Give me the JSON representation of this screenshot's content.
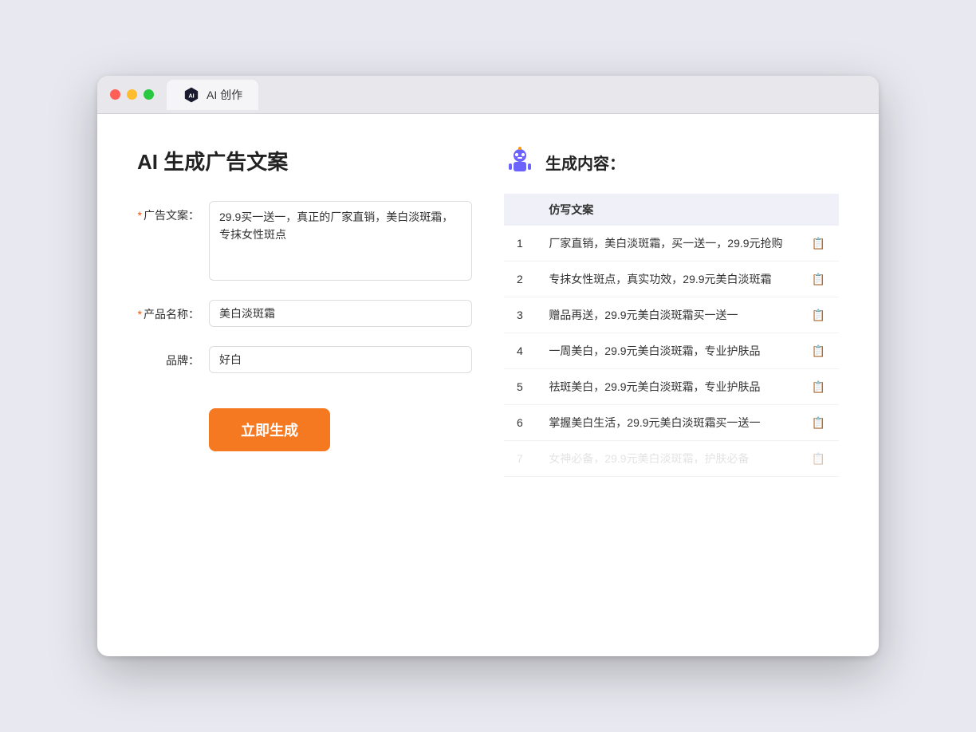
{
  "browser": {
    "tab_label": "AI 创作"
  },
  "page": {
    "title": "AI 生成广告文案"
  },
  "form": {
    "ad_copy_label": "广告文案：",
    "ad_copy_required": "*",
    "ad_copy_value": "29.9买一送一，真正的厂家直销，美白淡斑霜，专抹女性斑点",
    "product_name_label": "产品名称：",
    "product_name_required": "*",
    "product_name_value": "美白淡斑霜",
    "brand_label": "品牌：",
    "brand_value": "好白",
    "generate_btn_label": "立即生成"
  },
  "result": {
    "header_title": "生成内容：",
    "column_header": "仿写文案",
    "items": [
      {
        "num": "1",
        "text": "厂家直销，美白淡斑霜，买一送一，29.9元抢购"
      },
      {
        "num": "2",
        "text": "专抹女性斑点，真实功效，29.9元美白淡斑霜"
      },
      {
        "num": "3",
        "text": "赠品再送，29.9元美白淡斑霜买一送一"
      },
      {
        "num": "4",
        "text": "一周美白，29.9元美白淡斑霜，专业护肤品"
      },
      {
        "num": "5",
        "text": "祛斑美白，29.9元美白淡斑霜，专业护肤品"
      },
      {
        "num": "6",
        "text": "掌握美白生活，29.9元美白淡斑霜买一送一"
      },
      {
        "num": "7",
        "text": "女神必备，29.9元美白淡斑霜，护肤必备",
        "faded": true
      }
    ]
  }
}
